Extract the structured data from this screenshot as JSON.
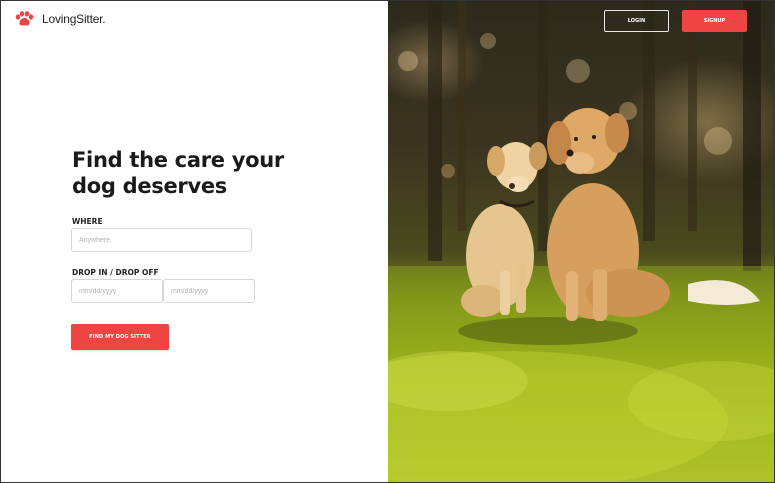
{
  "brand": {
    "name": "LovingSitter.",
    "logo_icon": "paw-icon",
    "accent": "#ef4444"
  },
  "nav": {
    "login_label": "LOGIN",
    "signup_label": "SIGNUP"
  },
  "hero": {
    "headline": "Find the care your dog deserves"
  },
  "search": {
    "where_label": "WHERE",
    "where_placeholder": "Anywhere",
    "dates_label": "DROP IN / DROP OFF",
    "drop_in_placeholder": "mm/dd/yyyy",
    "drop_off_placeholder": "mm/dd/yyyy",
    "submit_label": "FIND MY DOG SITTER"
  },
  "photo": {
    "subject": "two-dogs-photo"
  }
}
